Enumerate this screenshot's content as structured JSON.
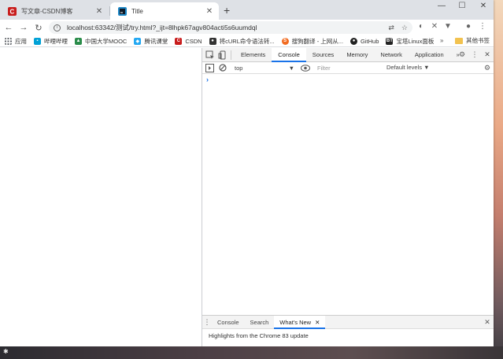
{
  "tabs": [
    {
      "title": "写文章-CSDN博客",
      "close": "✕",
      "favicon_color": "#c81d1d"
    },
    {
      "title": "Title",
      "close": "✕",
      "favicon_color": "#1e88c7"
    }
  ],
  "new_tab": "+",
  "window_controls": {
    "minimize": "—",
    "maximize": "☐",
    "close": "✕"
  },
  "toolbar": {
    "back": "←",
    "forward": "→",
    "reload": "↻",
    "info": "i",
    "url": "localhost:63342/测试/try.html?_ijt=8lhpk67agv804acti5s6uumdql",
    "translate_icon": "⇄",
    "star_icon": "☆",
    "extensions": [
      "◐",
      "✕",
      "▼"
    ],
    "profile_icon": "●",
    "menu_icon": "⋮"
  },
  "bookmarks": [
    {
      "label": "应用",
      "icon": "apps-grid",
      "color": "#5f6368"
    },
    {
      "label": "哔哩哔哩",
      "icon": "bilibili-icon",
      "color": "#00a1d6"
    },
    {
      "label": "中国大学MOOC",
      "icon": "mooc-icon",
      "color": "#2a8c4a"
    },
    {
      "label": "腾讯课堂",
      "icon": "tencent-icon",
      "color": "#23a8f2"
    },
    {
      "label": "CSDN",
      "icon": "csdn-icon",
      "color": "#c81d1d"
    },
    {
      "label": "将cURL命令语法转...",
      "icon": "curl-icon",
      "color": "#333333"
    },
    {
      "label": "搜狗翻译 - 上网从...",
      "icon": "sogou-icon",
      "color": "#f26c22"
    },
    {
      "label": "GitHub",
      "icon": "github-icon",
      "color": "#222222"
    },
    {
      "label": "宝塔Linux面板",
      "icon": "bt-icon",
      "color": "#222222"
    }
  ],
  "bookmarks_more": "»",
  "other_bookmarks": "其他书签",
  "devtools": {
    "tabs": [
      "Elements",
      "Console",
      "Sources",
      "Memory",
      "Network",
      "Application"
    ],
    "active_tab": "Console",
    "overflow": "»",
    "settings_icon": "⚙",
    "kebab_icon": "⋮",
    "close_icon": "✕",
    "context": "top",
    "context_caret": "▼",
    "filter_placeholder": "Filter",
    "levels": "Default levels ▼",
    "prompt": "›",
    "drawer": {
      "tabs": [
        "Console",
        "Search",
        "What's New"
      ],
      "active": "What's New",
      "close": "✕",
      "message": "Highlights from the Chrome 83 update"
    }
  },
  "accent_color": "#1a73e8"
}
